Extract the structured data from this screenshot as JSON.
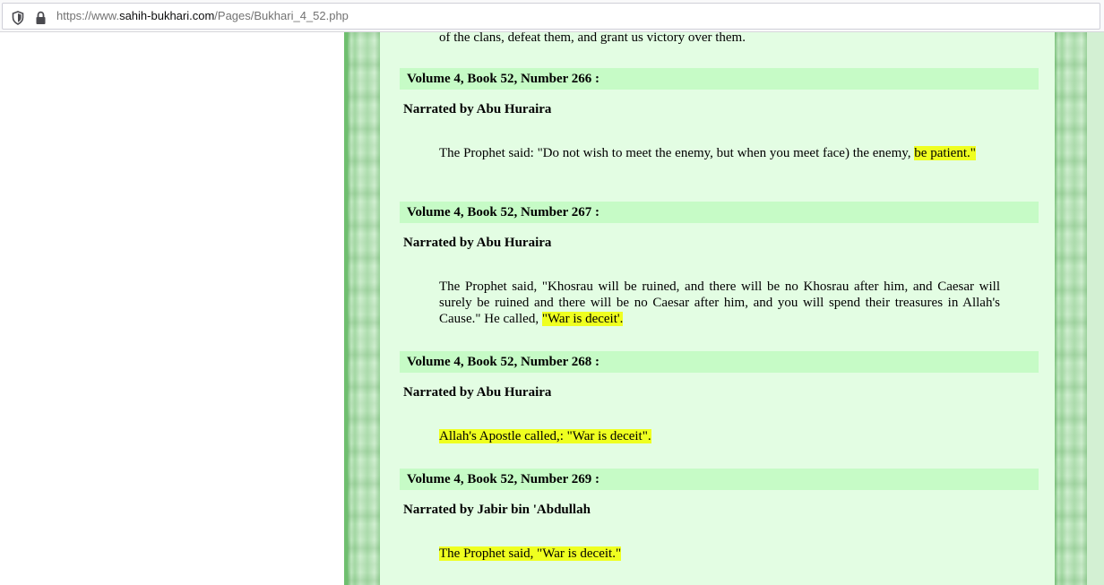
{
  "browser": {
    "url_prefix": "https://www.",
    "url_domain": "sahih-bukhari.com",
    "url_path": "/Pages/Bukhari_4_52.php",
    "shield_icon": "shield-icon",
    "lock_icon": "lock-icon"
  },
  "page": {
    "prev_text": "of the clans, defeat them, and grant us victory over them.",
    "hadiths": [
      {
        "header": "Volume 4, Book 52, Number 266 :",
        "narrator": "Narrated by Abu Huraira",
        "text_plain": "The Prophet said: \"Do not wish to meet the enemy, but when you meet face) the enemy, ",
        "text_highlight": "be patient.\""
      },
      {
        "header": "Volume 4, Book 52, Number 267 :",
        "narrator": "Narrated by Abu Huraira",
        "text_plain": "The Prophet said, \"Khosrau will be ruined, and there will be no Khosrau after him, and Caesar will surely be ruined and there will be no Caesar after him, and you will spend their treasures in Allah's Cause.\" He called, ",
        "text_highlight": "\"War is deceit'."
      },
      {
        "header": "Volume 4, Book 52, Number 268 :",
        "narrator": "Narrated by Abu Huraira",
        "text_plain": "",
        "text_highlight": "Allah's Apostle called,: \"War is deceit\"."
      },
      {
        "header": "Volume 4, Book 52, Number 269 :",
        "narrator": "Narrated by Jabir bin 'Abdullah",
        "text_plain": "",
        "text_highlight": "The Prophet said, \"War is deceit.\""
      }
    ],
    "colors": {
      "background": "#e3fde3",
      "header_band": "#c6fbc6",
      "highlight": "#efff20"
    }
  }
}
